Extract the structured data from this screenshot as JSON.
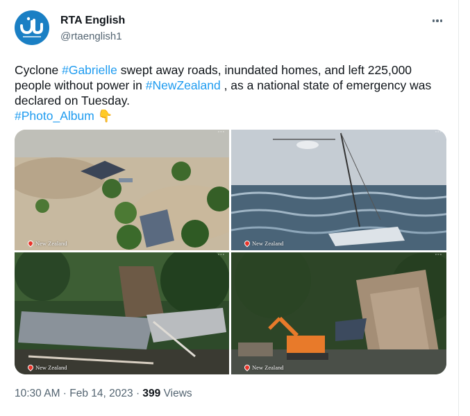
{
  "account": {
    "name": "RTA English",
    "handle": "@rtaenglish1"
  },
  "tweet": {
    "text_1": "Cyclone ",
    "tag_gabrielle": "#Gabrielle",
    "text_2": " swept away roads, inundated homes, and left 225,000 people without power in ",
    "tag_nz": "#NewZealand",
    "text_3": " , as a national state of emergency was declared on Tuesday.",
    "tag_album": "#Photo_Album",
    "emoji": "👇"
  },
  "photos": [
    {
      "location": "New Zealand",
      "icon": "flooded-houses"
    },
    {
      "location": "New Zealand",
      "icon": "helicopter-boat-storm"
    },
    {
      "location": "New Zealand",
      "icon": "collapsed-house"
    },
    {
      "location": "New Zealand",
      "icon": "excavator-landslide"
    }
  ],
  "meta": {
    "time": "10:30 AM",
    "sep1": " · ",
    "date": "Feb 14, 2023",
    "sep2": " · ",
    "views": "399",
    "views_label": " Views"
  },
  "colors": {
    "link": "#1d9bf0",
    "text": "#0f1419",
    "muted": "#536471",
    "avatar": "#1a7fc4"
  }
}
